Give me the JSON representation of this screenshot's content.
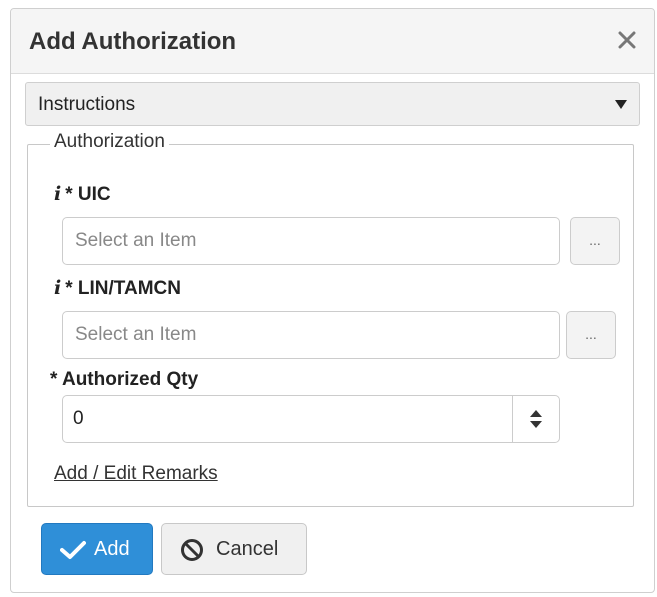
{
  "dialog": {
    "title": "Add Authorization",
    "close_icon": "close-icon"
  },
  "instructions": {
    "label": "Instructions",
    "icon": "caret-down-icon"
  },
  "authorization": {
    "legend": "Authorization",
    "uic": {
      "label": "UIC",
      "required_marker": "*",
      "info_icon": "i",
      "placeholder": "Select an Item",
      "lookup_label": "..."
    },
    "lin_tamcn": {
      "label": "LIN/TAMCN",
      "required_marker": "*",
      "info_icon": "i",
      "placeholder": "Select an Item",
      "lookup_label": "..."
    },
    "authorized_qty": {
      "label": "Authorized Qty",
      "required_marker": "*",
      "value": "0",
      "spinner_icon": "up-down-arrows-icon"
    },
    "remarks_link": "Add / Edit Remarks"
  },
  "actions": {
    "add_label": "Add",
    "add_icon": "check-icon",
    "cancel_label": "Cancel",
    "cancel_icon": "ban-icon"
  },
  "colors": {
    "primary": "#2f8fd8",
    "header_bg": "#f5f5f5"
  }
}
